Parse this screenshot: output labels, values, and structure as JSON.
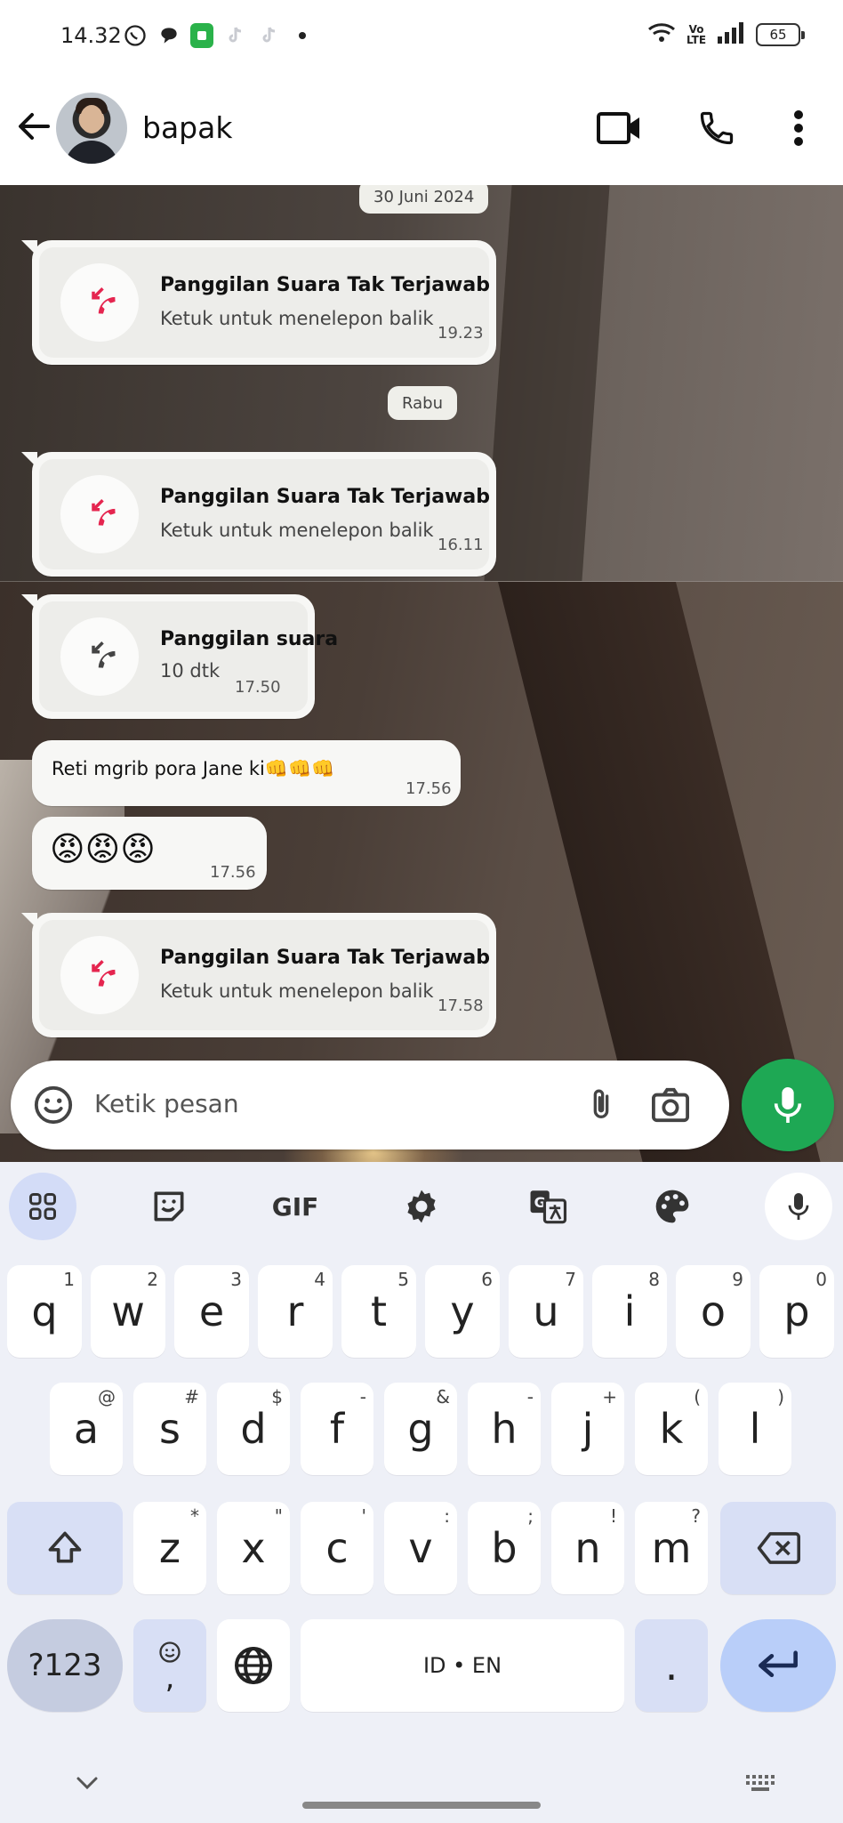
{
  "status_bar": {
    "time": "14.32",
    "battery": "65",
    "network_label": "Vo LTE"
  },
  "header": {
    "contact_name": "bapak"
  },
  "chat": {
    "date_1": "30 Juni 2024",
    "date_2": "Rabu",
    "call_1": {
      "title": "Panggilan Suara Tak Terjawab",
      "subtitle": "Ketuk untuk menelepon balik",
      "time": "19.23"
    },
    "call_2": {
      "title": "Panggilan Suara Tak Terjawab",
      "subtitle": "Ketuk untuk menelepon balik",
      "time": "16.11"
    },
    "call_3": {
      "title": "Panggilan suara",
      "subtitle": "10 dtk",
      "time": "17.50"
    },
    "msg_1": {
      "text": "Reti mgrib pora Jane ki",
      "emojis": "👊👊👊",
      "time": "17.56"
    },
    "msg_2": {
      "emojis": "😡😡😡",
      "time": "17.56"
    },
    "call_4": {
      "title": "Panggilan Suara Tak Terjawab",
      "subtitle": "Ketuk untuk menelepon balik",
      "time": "17.58"
    }
  },
  "composer": {
    "placeholder": "Ketik pesan"
  },
  "keyboard": {
    "gif_label": "GIF",
    "row1": [
      {
        "key": "q",
        "hint": "1"
      },
      {
        "key": "w",
        "hint": "2"
      },
      {
        "key": "e",
        "hint": "3"
      },
      {
        "key": "r",
        "hint": "4"
      },
      {
        "key": "t",
        "hint": "5"
      },
      {
        "key": "y",
        "hint": "6"
      },
      {
        "key": "u",
        "hint": "7"
      },
      {
        "key": "i",
        "hint": "8"
      },
      {
        "key": "o",
        "hint": "9"
      },
      {
        "key": "p",
        "hint": "0"
      }
    ],
    "row2": [
      {
        "key": "a",
        "hint": "@"
      },
      {
        "key": "s",
        "hint": "#"
      },
      {
        "key": "d",
        "hint": "$"
      },
      {
        "key": "f",
        "hint": "-"
      },
      {
        "key": "g",
        "hint": "&"
      },
      {
        "key": "h",
        "hint": "-"
      },
      {
        "key": "j",
        "hint": "+"
      },
      {
        "key": "k",
        "hint": "("
      },
      {
        "key": "l",
        "hint": ")"
      }
    ],
    "row3": [
      {
        "key": "z",
        "hint": "*"
      },
      {
        "key": "x",
        "hint": "\""
      },
      {
        "key": "c",
        "hint": "'"
      },
      {
        "key": "v",
        "hint": ":"
      },
      {
        "key": "b",
        "hint": ";"
      },
      {
        "key": "n",
        "hint": "!"
      },
      {
        "key": "m",
        "hint": "?"
      }
    ],
    "symbols_label": "?123",
    "comma_label": ",",
    "space_label": "ID • EN",
    "period_label": "."
  },
  "colors": {
    "missed_call": "#e5254f",
    "mic_fab": "#1ea854",
    "enter_key": "#b9cef9"
  }
}
